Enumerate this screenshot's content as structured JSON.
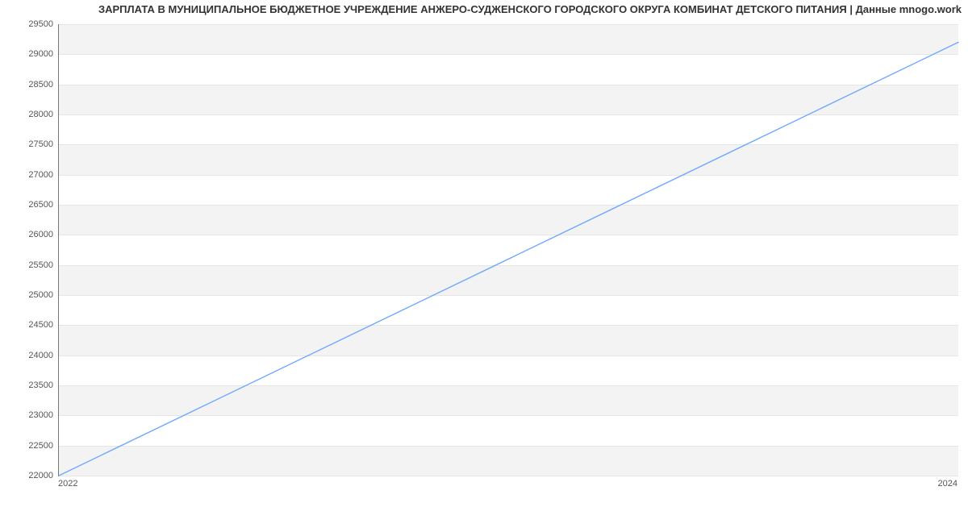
{
  "chart_data": {
    "type": "line",
    "title": "ЗАРПЛАТА В МУНИЦИПАЛЬНОЕ БЮДЖЕТНОЕ УЧРЕЖДЕНИЕ АНЖЕРО-СУДЖЕНСКОГО ГОРОДСКОГО ОКРУГА КОМБИНАТ ДЕТСКОГО ПИТАНИЯ | Данные mnogo.work",
    "x": [
      2022,
      2024
    ],
    "values": [
      22000,
      29200
    ],
    "xlabel": "",
    "ylabel": "",
    "xlim": [
      2022,
      2024
    ],
    "ylim": [
      22000,
      29500
    ],
    "yticks": [
      22000,
      22500,
      23000,
      23500,
      24000,
      24500,
      25000,
      25500,
      26000,
      26500,
      27000,
      27500,
      28000,
      28500,
      29000,
      29500
    ],
    "xticks": [
      2022,
      2024
    ],
    "line_color": "#6fa8ff",
    "grid": true
  }
}
